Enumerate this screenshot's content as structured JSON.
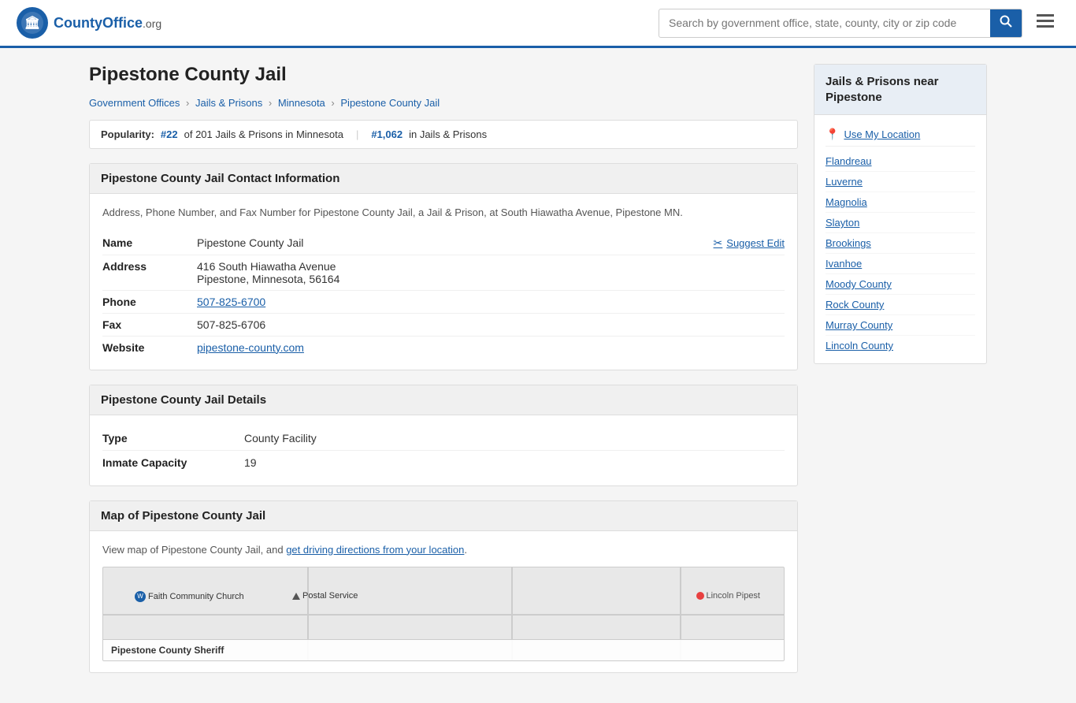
{
  "header": {
    "logo_text": "CountyOffice",
    "logo_suffix": ".org",
    "search_placeholder": "Search by government office, state, county, city or zip code",
    "search_btn_icon": "🔍"
  },
  "page": {
    "title": "Pipestone County Jail"
  },
  "breadcrumb": {
    "items": [
      {
        "label": "Government Offices",
        "href": "#"
      },
      {
        "label": "Jails & Prisons",
        "href": "#"
      },
      {
        "label": "Minnesota",
        "href": "#"
      },
      {
        "label": "Pipestone County Jail",
        "href": "#"
      }
    ]
  },
  "popularity": {
    "label": "Popularity:",
    "rank1": "#22",
    "rank1_text": "of 201 Jails & Prisons in Minnesota",
    "rank2": "#1,062",
    "rank2_text": "in Jails & Prisons"
  },
  "contact_section": {
    "title": "Pipestone County Jail Contact Information",
    "description": "Address, Phone Number, and Fax Number for Pipestone County Jail, a Jail & Prison, at South Hiawatha Avenue, Pipestone MN.",
    "fields": {
      "name_label": "Name",
      "name_value": "Pipestone County Jail",
      "address_label": "Address",
      "address_line1": "416 South Hiawatha Avenue",
      "address_line2": "Pipestone, Minnesota, 56164",
      "phone_label": "Phone",
      "phone_value": "507-825-6700",
      "fax_label": "Fax",
      "fax_value": "507-825-6706",
      "website_label": "Website",
      "website_value": "pipestone-county.com",
      "suggest_edit": "Suggest Edit"
    }
  },
  "details_section": {
    "title": "Pipestone County Jail Details",
    "fields": {
      "type_label": "Type",
      "type_value": "County Facility",
      "capacity_label": "Inmate Capacity",
      "capacity_value": "19"
    }
  },
  "map_section": {
    "title": "Map of Pipestone County Jail",
    "description": "View map of Pipestone County Jail, and",
    "link_text": "get driving directions from your location",
    "description_end": ".",
    "map_labels": {
      "church": "Faith Community Church",
      "postal": "Postal Service",
      "lincoln": "Lincoln Pipest",
      "sheriff": "Pipestone County Sheriff"
    }
  },
  "sidebar": {
    "title": "Jails & Prisons near Pipestone",
    "use_location": "Use My Location",
    "links": [
      "Flandreau",
      "Luverne",
      "Magnolia",
      "Slayton",
      "Brookings",
      "Ivanhoe",
      "Moody County",
      "Rock County",
      "Murray County",
      "Lincoln County"
    ]
  }
}
